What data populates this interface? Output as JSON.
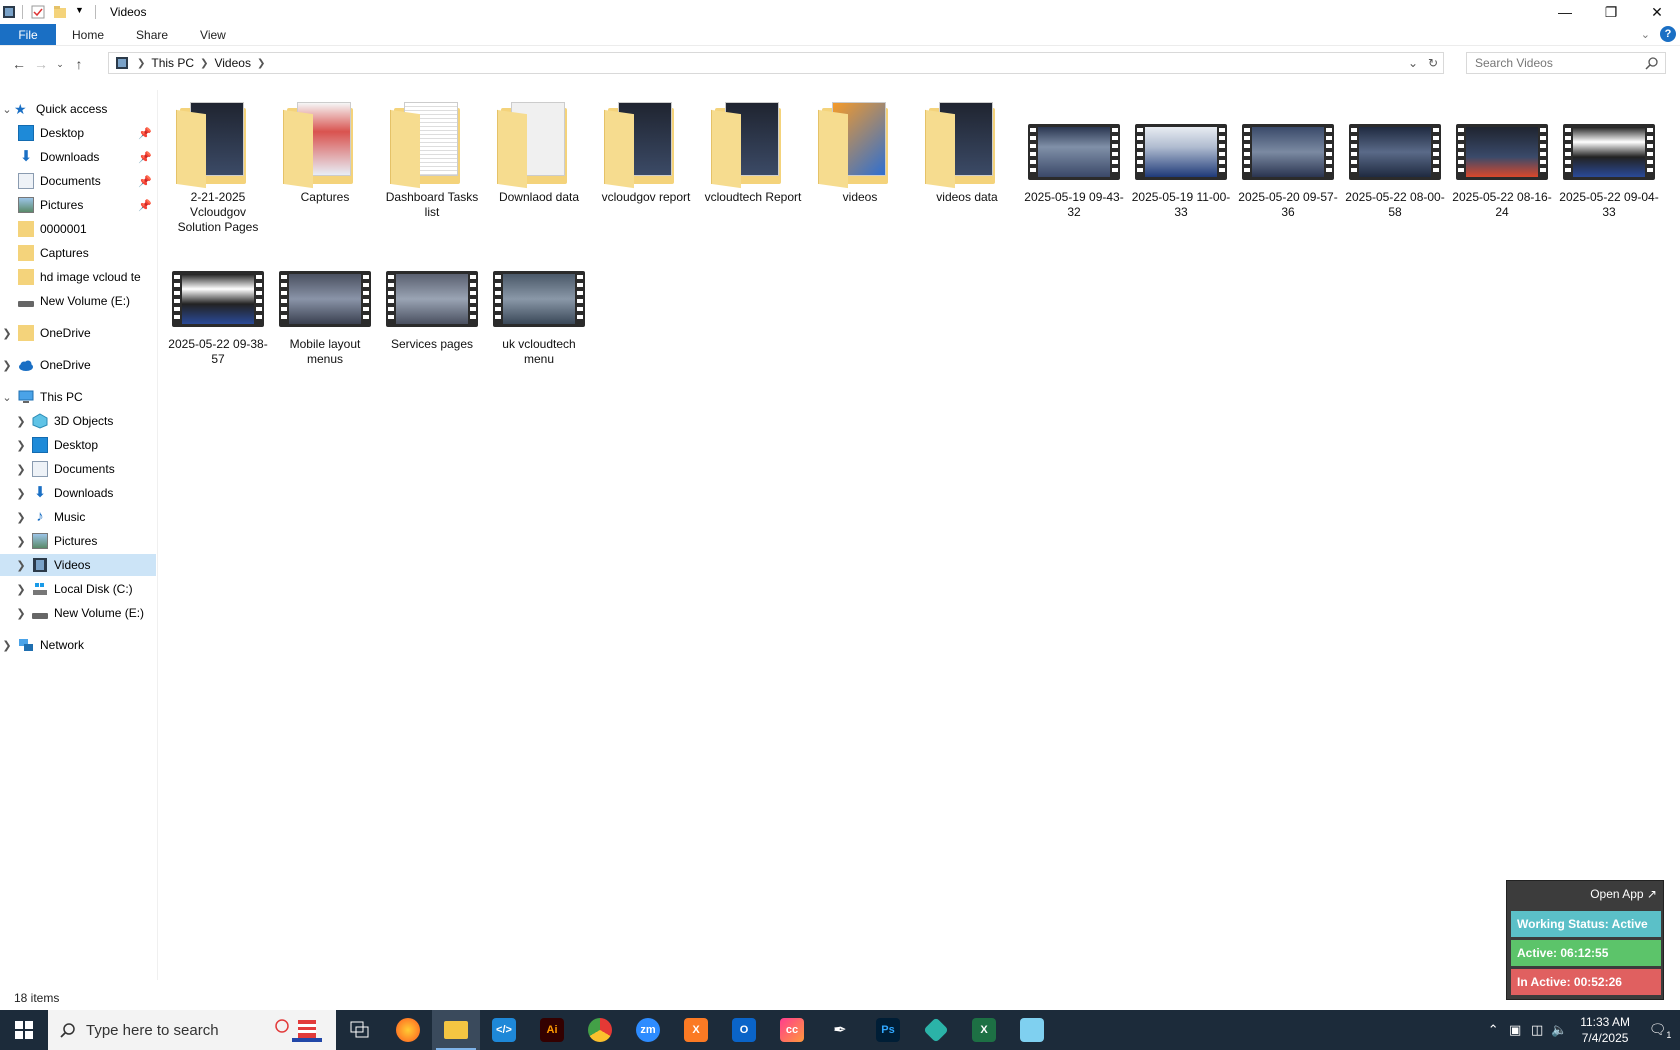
{
  "window": {
    "title": "Videos"
  },
  "ribbon": {
    "tabs": [
      "File",
      "Home",
      "Share",
      "View"
    ]
  },
  "address": {
    "segments": [
      "This PC",
      "Videos"
    ]
  },
  "search": {
    "placeholder": "Search Videos"
  },
  "nav": {
    "quick_access": "Quick access",
    "quick_items": [
      "Desktop",
      "Downloads",
      "Documents",
      "Pictures",
      "0000001",
      "Captures",
      "hd image vcloud te",
      "New Volume (E:)"
    ],
    "onedrive1": "OneDrive",
    "onedrive2": "OneDrive",
    "this_pc": "This PC",
    "pc_items": [
      "3D Objects",
      "Desktop",
      "Documents",
      "Downloads",
      "Music",
      "Pictures",
      "Videos",
      "Local Disk (C:)",
      "New Volume (E:)"
    ],
    "network": "Network"
  },
  "files": [
    {
      "label": "2-21-2025 Vcloudgov Solution Pages",
      "kind": "folder"
    },
    {
      "label": "Captures",
      "kind": "folder"
    },
    {
      "label": "Dashboard Tasks list",
      "kind": "folder"
    },
    {
      "label": "Downlaod data",
      "kind": "folder"
    },
    {
      "label": "vcloudgov report",
      "kind": "folder"
    },
    {
      "label": "vcloudtech Report",
      "kind": "folder"
    },
    {
      "label": "videos",
      "kind": "folder"
    },
    {
      "label": "videos data",
      "kind": "folder"
    },
    {
      "label": "2025-05-19 09-43-32",
      "kind": "video"
    },
    {
      "label": "2025-05-19 11-00-33",
      "kind": "video"
    },
    {
      "label": "2025-05-20 09-57-36",
      "kind": "video"
    },
    {
      "label": "2025-05-22 08-00-58",
      "kind": "video"
    },
    {
      "label": "2025-05-22 08-16-24",
      "kind": "video"
    },
    {
      "label": "2025-05-22 09-04-33",
      "kind": "video"
    },
    {
      "label": "2025-05-22 09-38-57",
      "kind": "video"
    },
    {
      "label": "Mobile layout menus",
      "kind": "video"
    },
    {
      "label": "Services pages",
      "kind": "video"
    },
    {
      "label": "uk vcloudtech menu",
      "kind": "video"
    }
  ],
  "status": {
    "item_count": "18 items"
  },
  "tracker": {
    "open_app": "Open App ↗",
    "working_status": "Working Status: Active",
    "active": "Active: 06:12:55",
    "inactive": "In Active: 00:52:26"
  },
  "taskbar": {
    "search_placeholder": "Type here to search",
    "time": "11:33 AM",
    "date": "7/4/2025",
    "notification_count": "1"
  },
  "colors": {
    "accent": "#1a6fc4",
    "selected": "#cce4f7",
    "working": "#5bc0c8",
    "active": "#5cc46a",
    "inactive": "#e06060",
    "taskbar": "#1c2b3a"
  }
}
